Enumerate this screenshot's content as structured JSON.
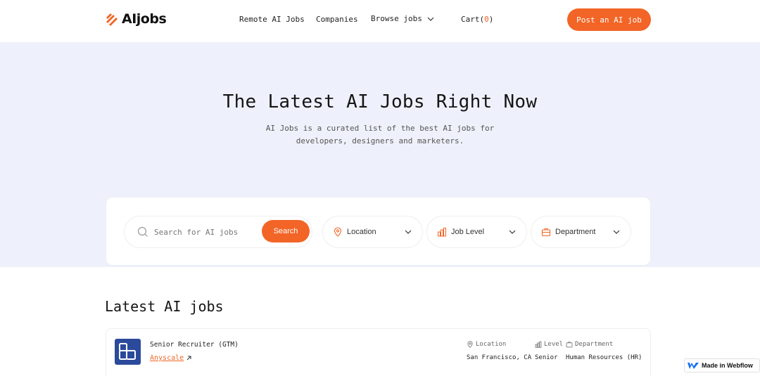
{
  "brand": {
    "name": "AIjobs",
    "accent": "#f26527"
  },
  "nav": {
    "links": [
      "Remote AI Jobs",
      "Companies",
      "Browse jobs"
    ],
    "cart_label": "Cart(",
    "cart_count": "0",
    "cart_close": ")",
    "post_button": "Post an AI job"
  },
  "hero": {
    "title": "The Latest AI Jobs Right Now",
    "subtitle_line1": "AI Jobs is a curated list of the best AI jobs for",
    "subtitle_line2": "developers, designers and marketers."
  },
  "search": {
    "placeholder": "Search for AI jobs",
    "button": "Search",
    "filters": [
      "Location",
      "Job Level",
      "Department"
    ]
  },
  "latest": {
    "title": "Latest AI jobs",
    "jobs": [
      {
        "title": "Senior Recruiter (GTM)",
        "company": "Anyscale",
        "location_label": "Location",
        "level_label": "Level",
        "department_label": "Department",
        "location": "San Francisco, CA",
        "level": "Senior",
        "department": "Human Resources (HR)"
      }
    ]
  },
  "badge": {
    "label": "Made in Webflow"
  },
  "icons": [
    "logo-icon",
    "chevron-down-icon",
    "search-icon",
    "location-pin-icon",
    "bar-chart-icon",
    "briefcase-icon",
    "arrow-up-right-icon",
    "webflow-icon"
  ]
}
